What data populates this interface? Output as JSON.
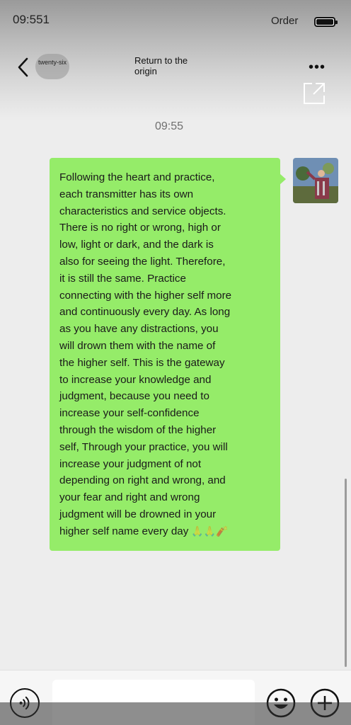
{
  "status_bar": {
    "time": "09:551",
    "carrier": "Order"
  },
  "nav": {
    "badge": "twenty-six",
    "title": "Return to the origin",
    "more_icon": "more-dots-icon",
    "back_icon": "chevron-left-icon",
    "external_icon": "open-external-icon"
  },
  "chat": {
    "timestamp": "09:55",
    "message_lines": [
      "Following the heart and practice,",
      "each transmitter has its own",
      "characteristics and service objects.",
      "There is no right or wrong, high or",
      "low, light or dark, and the dark is",
      "also for seeing the light. Therefore,",
      " it is still the same. Practice",
      "connecting with the higher self more",
      "and continuously every day. As long",
      "as you have any distractions, you",
      "will drown them with the name of",
      "the higher self. This is the gateway",
      "to increase your knowledge and",
      "judgment, because you need to",
      "increase your self-confidence",
      "through the wisdom of the higher",
      "self, Through your practice, you will",
      "increase your judgment of not",
      "depending on right and wrong, and",
      "your fear and right and wrong",
      "judgment will be drowned in your",
      "higher self name every day"
    ],
    "trailing_emoji": "🙏🙏🧨"
  },
  "input_bar": {
    "voice_icon": "voice-icon",
    "emoji_icon": "smile-icon",
    "plus_icon": "plus-circle-icon",
    "input_value": ""
  },
  "colors": {
    "bubble": "#95ec69",
    "background": "#ededed"
  }
}
